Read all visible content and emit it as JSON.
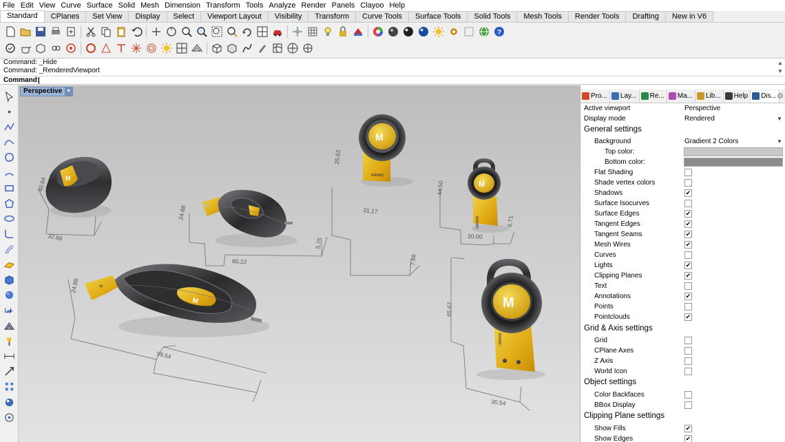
{
  "menu": [
    "File",
    "Edit",
    "View",
    "Curve",
    "Surface",
    "Solid",
    "Mesh",
    "Dimension",
    "Transform",
    "Tools",
    "Analyze",
    "Render",
    "Panels",
    "Clayoo",
    "Help"
  ],
  "toolbar_tabs": [
    {
      "label": "Standard",
      "active": true
    },
    {
      "label": "CPlanes"
    },
    {
      "label": "Set View"
    },
    {
      "label": "Display"
    },
    {
      "label": "Select"
    },
    {
      "label": "Viewport Layout"
    },
    {
      "label": "Visibility"
    },
    {
      "label": "Transform"
    },
    {
      "label": "Curve Tools"
    },
    {
      "label": "Surface Tools"
    },
    {
      "label": "Solid Tools"
    },
    {
      "label": "Mesh Tools"
    },
    {
      "label": "Render Tools"
    },
    {
      "label": "Drafting"
    },
    {
      "label": "New in V6"
    }
  ],
  "toolbar_row1_icons": [
    "new-file-icon",
    "open-file-icon",
    "save-icon",
    "print-icon",
    "import-icon",
    "cut-icon",
    "copy-icon",
    "paste-icon",
    "undo-icon",
    "pan-icon",
    "rotate-view-icon",
    "zoom-icon",
    "zoom-window-icon",
    "zoom-extents-icon",
    "zoom-selected-icon",
    "rotate-icon",
    "four-viewports-icon",
    "car-icon",
    "move-icon",
    "grid-icon",
    "light-icon",
    "lock-icon",
    "hide-icon",
    "color-wheel-icon",
    "material-sphere-icon",
    "render-sphere-icon",
    "environment-sphere-icon",
    "sun-icon",
    "options-icon",
    "dots-icon",
    "globe-icon",
    "help-icon"
  ],
  "toolbar_row2_icons": [
    "osnap-icon",
    "teapot-icon",
    "package-icon",
    "chain-icon",
    "record-icon",
    "ring-icon",
    "cut-plane-icon",
    "t-shape-icon",
    "spark-icon",
    "target-icon",
    "sun-icon",
    "grid-snap-icon",
    "mesh-icon",
    "box-icon",
    "cube-icon",
    "sweep-icon",
    "brush-icon",
    "network-icon",
    "globe-grid-icon",
    "gumball-icon"
  ],
  "command": {
    "history": [
      "Command: _Hide",
      "Command: _RenderedViewport"
    ],
    "prompt": "Command:"
  },
  "left_tools": [
    "select-arrow-icon",
    "point-icon",
    "polyline-icon",
    "curve-icon",
    "circle-icon",
    "arc-icon",
    "rectangle-icon",
    "polygon-icon",
    "ellipse-icon",
    "fillet-icon",
    "offset-icon",
    "surface-icon",
    "box-solid-icon",
    "sphere-icon",
    "extrude-icon",
    "mesh-tool-icon",
    "lamp-icon",
    "dimension-icon",
    "transform-icon",
    "array-icon",
    "render-icon",
    "analyze-icon"
  ],
  "viewport": {
    "label": "Perspective",
    "dimensions": [
      {
        "id": "d1",
        "text": "40.84"
      },
      {
        "id": "d2",
        "text": "32.88"
      },
      {
        "id": "d3",
        "text": "24.88"
      },
      {
        "id": "d4",
        "text": "60.22"
      },
      {
        "id": "d5",
        "text": "5.75"
      },
      {
        "id": "d6",
        "text": "24.88"
      },
      {
        "id": "d7",
        "text": "99.54"
      },
      {
        "id": "d8",
        "text": "25.62"
      },
      {
        "id": "d9",
        "text": "31.17"
      },
      {
        "id": "d10",
        "text": "7.88"
      },
      {
        "id": "d11",
        "text": "44.50"
      },
      {
        "id": "d12",
        "text": "20.00"
      },
      {
        "id": "d13",
        "text": "6.71"
      },
      {
        "id": "d14",
        "text": "65.67"
      },
      {
        "id": "d15",
        "text": "30.54"
      }
    ]
  },
  "panel": {
    "tabs": [
      {
        "label": "Pro...",
        "color": "#d04a2a"
      },
      {
        "label": "Lay...",
        "color": "#3a6ab0"
      },
      {
        "label": "Re...",
        "color": "#2a8a4a"
      },
      {
        "label": "Ma...",
        "color": "#b04ab0"
      },
      {
        "label": "Lib...",
        "color": "#c89a2a"
      },
      {
        "label": "Help",
        "color": "#3a3a3a"
      },
      {
        "label": "Dis...",
        "color": "#2a5a9a",
        "active": true
      }
    ],
    "gear": "⚙",
    "active_viewport": {
      "label": "Active viewport",
      "value": "Perspective"
    },
    "display_mode": {
      "label": "Display mode",
      "value": "Rendered"
    },
    "sections": {
      "general": "General settings",
      "grid": "Grid & Axis settings",
      "object": "Object settings",
      "clipping": "Clipping Plane settings"
    },
    "background": {
      "label": "Background",
      "value": "Gradient 2 Colors"
    },
    "top_color": {
      "label": "Top color:",
      "color": "#c8c8c8"
    },
    "bottom_color": {
      "label": "Bottom color:",
      "color": "#8c8c8c"
    },
    "general_items": [
      {
        "label": "Flat Shading",
        "checked": false
      },
      {
        "label": "Shade vertex colors",
        "checked": false
      },
      {
        "label": "Shadows",
        "checked": true
      },
      {
        "label": "Surface Isocurves",
        "checked": false
      },
      {
        "label": "Surface Edges",
        "checked": true
      },
      {
        "label": "Tangent Edges",
        "checked": true
      },
      {
        "label": "Tangent Seams",
        "checked": true
      },
      {
        "label": "Mesh Wires",
        "checked": true
      },
      {
        "label": "Curves",
        "checked": false
      },
      {
        "label": "Lights",
        "checked": true
      },
      {
        "label": "Clipping Planes",
        "checked": true
      },
      {
        "label": "Text",
        "checked": false
      },
      {
        "label": "Annotations",
        "checked": true
      },
      {
        "label": "Points",
        "checked": false
      },
      {
        "label": "Pointclouds",
        "checked": true
      }
    ],
    "grid_items": [
      {
        "label": "Grid",
        "checked": false
      },
      {
        "label": "CPlane Axes",
        "checked": false
      },
      {
        "label": "Z Axis",
        "checked": false
      },
      {
        "label": "World Icon",
        "checked": false
      }
    ],
    "object_items": [
      {
        "label": "Color Backfaces",
        "checked": false
      },
      {
        "label": "BBox Display",
        "checked": false
      }
    ],
    "clipping_items": [
      {
        "label": "Show Fills",
        "checked": true
      },
      {
        "label": "Show Edges",
        "checked": true
      }
    ]
  },
  "colors": {
    "gold": "#e8b820",
    "dark_metal": "#3a3a3c",
    "viewport_tab": "#9ab5d6"
  }
}
